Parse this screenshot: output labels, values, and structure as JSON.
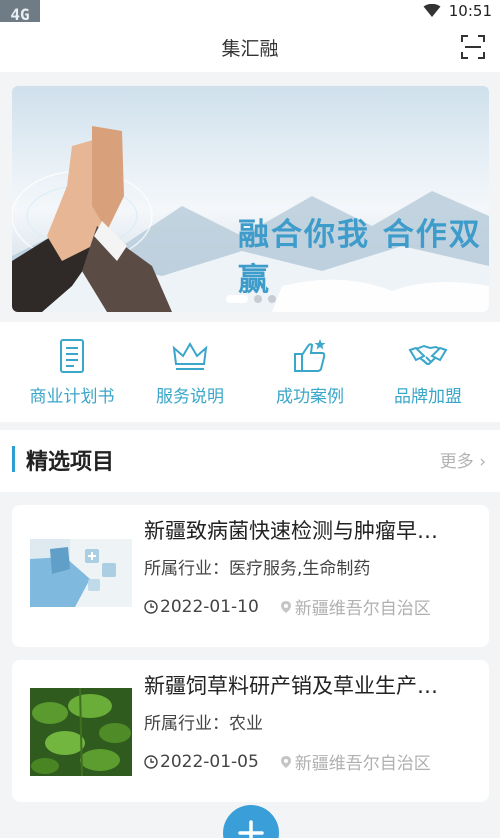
{
  "status_bar": {
    "network_badge": "4G",
    "time": "10:51"
  },
  "nav": {
    "title": "集汇融",
    "scan_icon": "scan-icon"
  },
  "banner": {
    "slogan": "融合你我  合作双赢",
    "active_slide": 1,
    "slide_count": 3
  },
  "menu": [
    {
      "label": "商业计划书",
      "icon": "document-icon"
    },
    {
      "label": "服务说明",
      "icon": "crown-icon"
    },
    {
      "label": "成功案例",
      "icon": "thumbs-up-icon"
    },
    {
      "label": "品牌加盟",
      "icon": "handshake-icon"
    }
  ],
  "section": {
    "title": "精选项目",
    "more": "更多"
  },
  "projects": [
    {
      "title": "新疆致病菌快速检测与肿瘤早…",
      "industry": "所属行业：医疗服务,生命制药",
      "date": "2022-01-10",
      "location": "新疆维吾尔自治区"
    },
    {
      "title": "新疆饲草料研产销及草业生产…",
      "industry": "所属行业：农业",
      "date": "2022-01-05",
      "location": "新疆维吾尔自治区"
    }
  ],
  "colors": {
    "accent": "#3aa6c9",
    "fab": "#3a9fd9",
    "slogan": "#3e9ccb"
  }
}
